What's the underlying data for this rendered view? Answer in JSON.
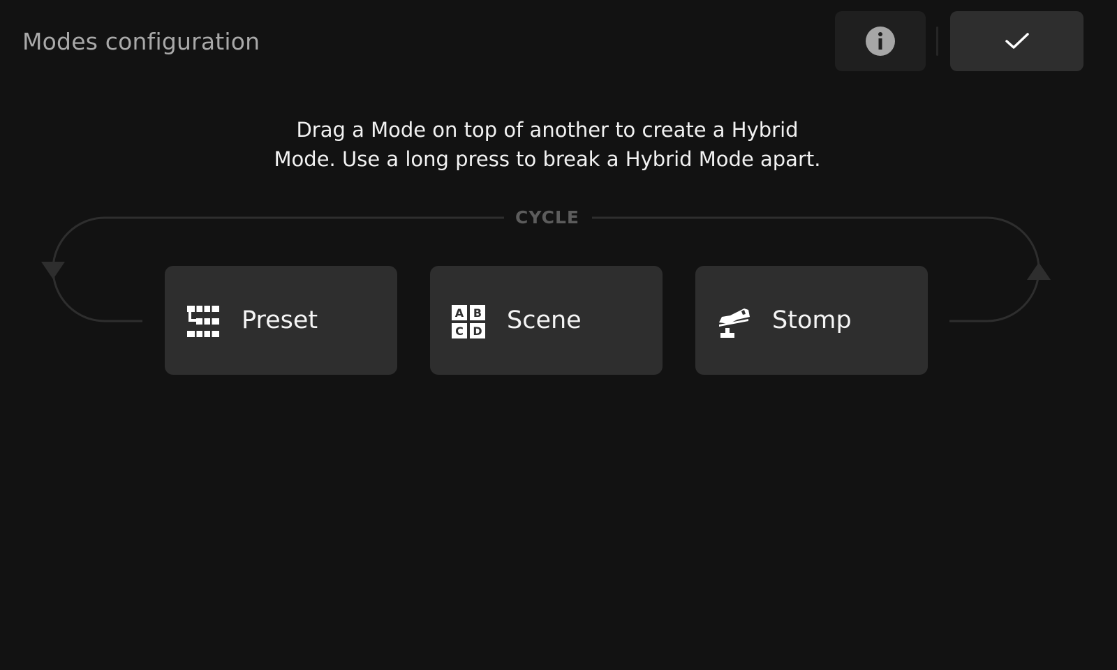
{
  "header": {
    "title": "Modes configuration",
    "info_icon": "info-circle-icon",
    "done_icon": "checkmark-icon"
  },
  "instructions": {
    "line1": "Drag a Mode on top of another to create a Hybrid",
    "line2": "Mode. Use a long press to break a Hybrid Mode apart."
  },
  "cycle": {
    "label": "CYCLE"
  },
  "modes": [
    {
      "label": "Preset",
      "icon": "preset-chain-icon"
    },
    {
      "label": "Scene",
      "icon": "abcd-grid-icon"
    },
    {
      "label": "Stomp",
      "icon": "stomp-footswitch-icon"
    }
  ],
  "colors": {
    "background": "#121212",
    "card": "#2e2e2e",
    "info_button": "#1f1f1f",
    "title_text": "#a9a9a9",
    "cycle_line": "#2e2e2e",
    "cycle_label": "#5c5c5c"
  }
}
